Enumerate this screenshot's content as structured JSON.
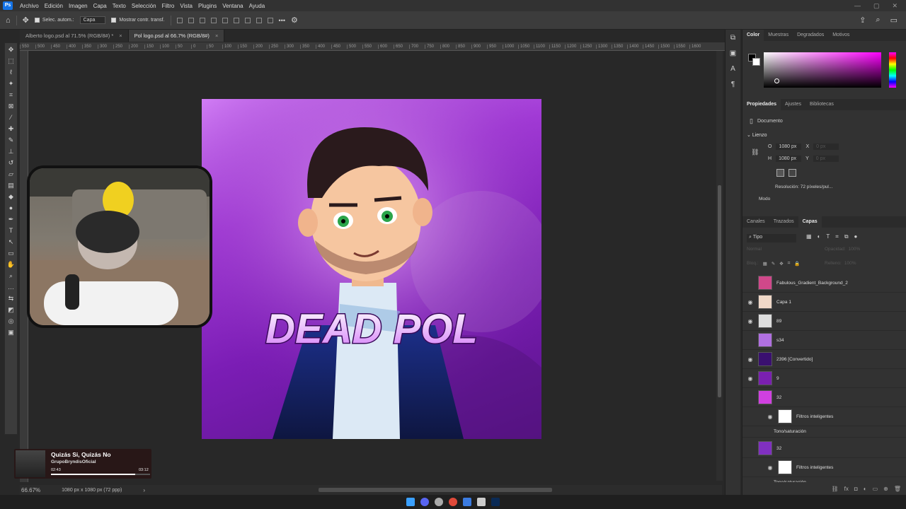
{
  "menu": {
    "logo": "Ps",
    "items": [
      "Archivo",
      "Edición",
      "Imagen",
      "Capa",
      "Texto",
      "Selección",
      "Filtro",
      "Vista",
      "Plugins",
      "Ventana",
      "Ayuda"
    ]
  },
  "options": {
    "auto_select": "Selec. autom.:",
    "layer_select": "Capa",
    "show_transform": "Mostrar contr. transf.",
    "more": "•••"
  },
  "tabs": [
    {
      "label": "Alberto logo.psd al 71.5% (RGB/8#) *",
      "close": "×"
    },
    {
      "label": "Pol logo.psd al 66.7% (RGB/8#)",
      "close": "×"
    }
  ],
  "ruler_ticks": [
    "550",
    "500",
    "450",
    "400",
    "350",
    "300",
    "250",
    "200",
    "150",
    "100",
    "50",
    "0",
    "50",
    "100",
    "150",
    "200",
    "250",
    "300",
    "350",
    "400",
    "450",
    "500",
    "550",
    "600",
    "650",
    "700",
    "750",
    "800",
    "850",
    "900",
    "950",
    "1000",
    "1050",
    "1100",
    "1150",
    "1200",
    "1250",
    "1300",
    "1350",
    "1400",
    "1450",
    "1500",
    "1550",
    "1600"
  ],
  "artwork": {
    "title": "DEAD POL"
  },
  "music": {
    "title": "Quizás Si, Quizás No",
    "artist": "GrupoBryndisOficial",
    "elapsed": "02:43",
    "total": "03:12",
    "progress": 0.85
  },
  "status": {
    "zoom": "66.67%",
    "doc": "1080 px x 1080 px (72 ppp)"
  },
  "color_panel": {
    "tabs": [
      "Color",
      "Muestras",
      "Degradados",
      "Motivos"
    ]
  },
  "props_panel": {
    "tabs": [
      "Propiedades",
      "Ajustes",
      "Bibliotecas"
    ],
    "doc_label": "Documento",
    "canvas_label": "Lienzo",
    "w_label": "O",
    "w_value": "1080 px",
    "h_label": "H",
    "h_value": "1080 px",
    "x_label": "X",
    "x_value": "0 px",
    "y_label": "Y",
    "y_value": "0 px",
    "resolution": "Resolución: 72 píxeles/pul...",
    "mode": "Modo"
  },
  "layers_panel": {
    "tabs": [
      "Canales",
      "Trazados",
      "Capas"
    ],
    "filter": "Tipo",
    "blend": "Normal",
    "opacity_label": "Opacidad:",
    "opacity": "100%",
    "lock_label": "Bloq.:",
    "fill_label": "Relleno:",
    "fill": "100%",
    "layers": [
      {
        "name": "Fabulous_Gradient_Background_2",
        "visible": false,
        "color": "#d0488a"
      },
      {
        "name": "Capa 1",
        "visible": true,
        "color": "#f0d8c8"
      },
      {
        "name": "89",
        "visible": true,
        "color": "#dddddd"
      },
      {
        "name": "s34",
        "visible": false,
        "color": "#b070e0"
      },
      {
        "name": "2396 [Convertido]",
        "visible": true,
        "color": "#3a1070"
      },
      {
        "name": "9",
        "visible": true,
        "color": "#7a20b0"
      },
      {
        "name": "32",
        "visible": false,
        "color": "#d040e0"
      },
      {
        "name": "Filtros inteligentes",
        "sub": true,
        "visible": true,
        "color": "#ffffff"
      },
      {
        "name": "Tono/saturación",
        "subsub": true
      },
      {
        "name": "32",
        "visible": false,
        "color": "#8030c0"
      },
      {
        "name": "Filtros inteligentes",
        "sub": true,
        "visible": true,
        "color": "#ffffff"
      },
      {
        "name": "Tono/saturación",
        "subsub": true
      }
    ]
  }
}
